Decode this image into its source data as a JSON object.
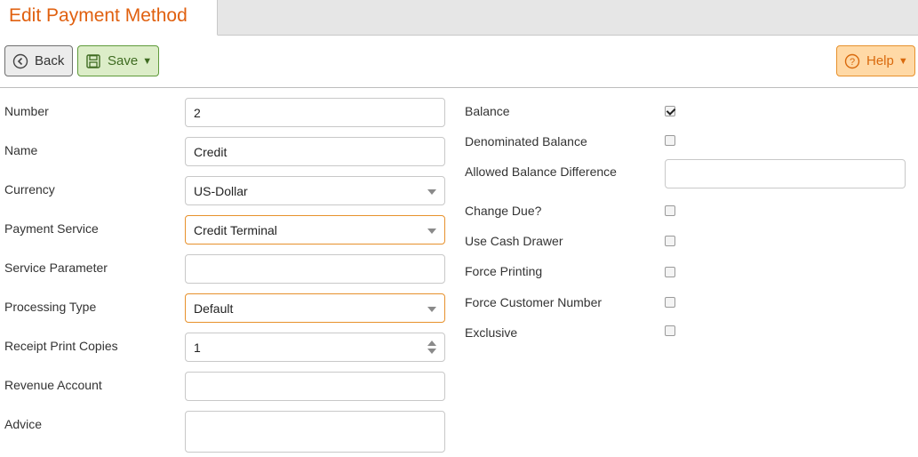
{
  "header": {
    "title": "Edit Payment Method"
  },
  "toolbar": {
    "back_label": "Back",
    "save_label": "Save",
    "help_label": "Help"
  },
  "form_left": {
    "number": {
      "label": "Number",
      "value": "2"
    },
    "name": {
      "label": "Name",
      "value": "Credit"
    },
    "currency": {
      "label": "Currency",
      "value": "US-Dollar"
    },
    "payment_service": {
      "label": "Payment Service",
      "value": "Credit Terminal"
    },
    "service_parameter": {
      "label": "Service Parameter",
      "value": ""
    },
    "processing_type": {
      "label": "Processing Type",
      "value": "Default"
    },
    "receipt_print_copies": {
      "label": "Receipt Print Copies",
      "value": "1"
    },
    "revenue_account": {
      "label": "Revenue Account",
      "value": ""
    },
    "advice": {
      "label": "Advice",
      "value": ""
    }
  },
  "form_right": {
    "balance": {
      "label": "Balance",
      "checked": true
    },
    "denominated_balance": {
      "label": "Denominated Balance",
      "checked": false
    },
    "allowed_balance_difference": {
      "label": "Allowed Balance Difference",
      "value": ""
    },
    "change_due": {
      "label": "Change Due?",
      "checked": false
    },
    "use_cash_drawer": {
      "label": "Use Cash Drawer",
      "checked": false
    },
    "force_printing": {
      "label": "Force Printing",
      "checked": false
    },
    "force_customer_number": {
      "label": "Force Customer Number",
      "checked": false
    },
    "exclusive": {
      "label": "Exclusive",
      "checked": false
    }
  },
  "colors": {
    "title": "#e0600f",
    "save_bg": "#dcedc8",
    "help_bg": "#ffd9a6",
    "highlight_border": "#e7912c"
  }
}
